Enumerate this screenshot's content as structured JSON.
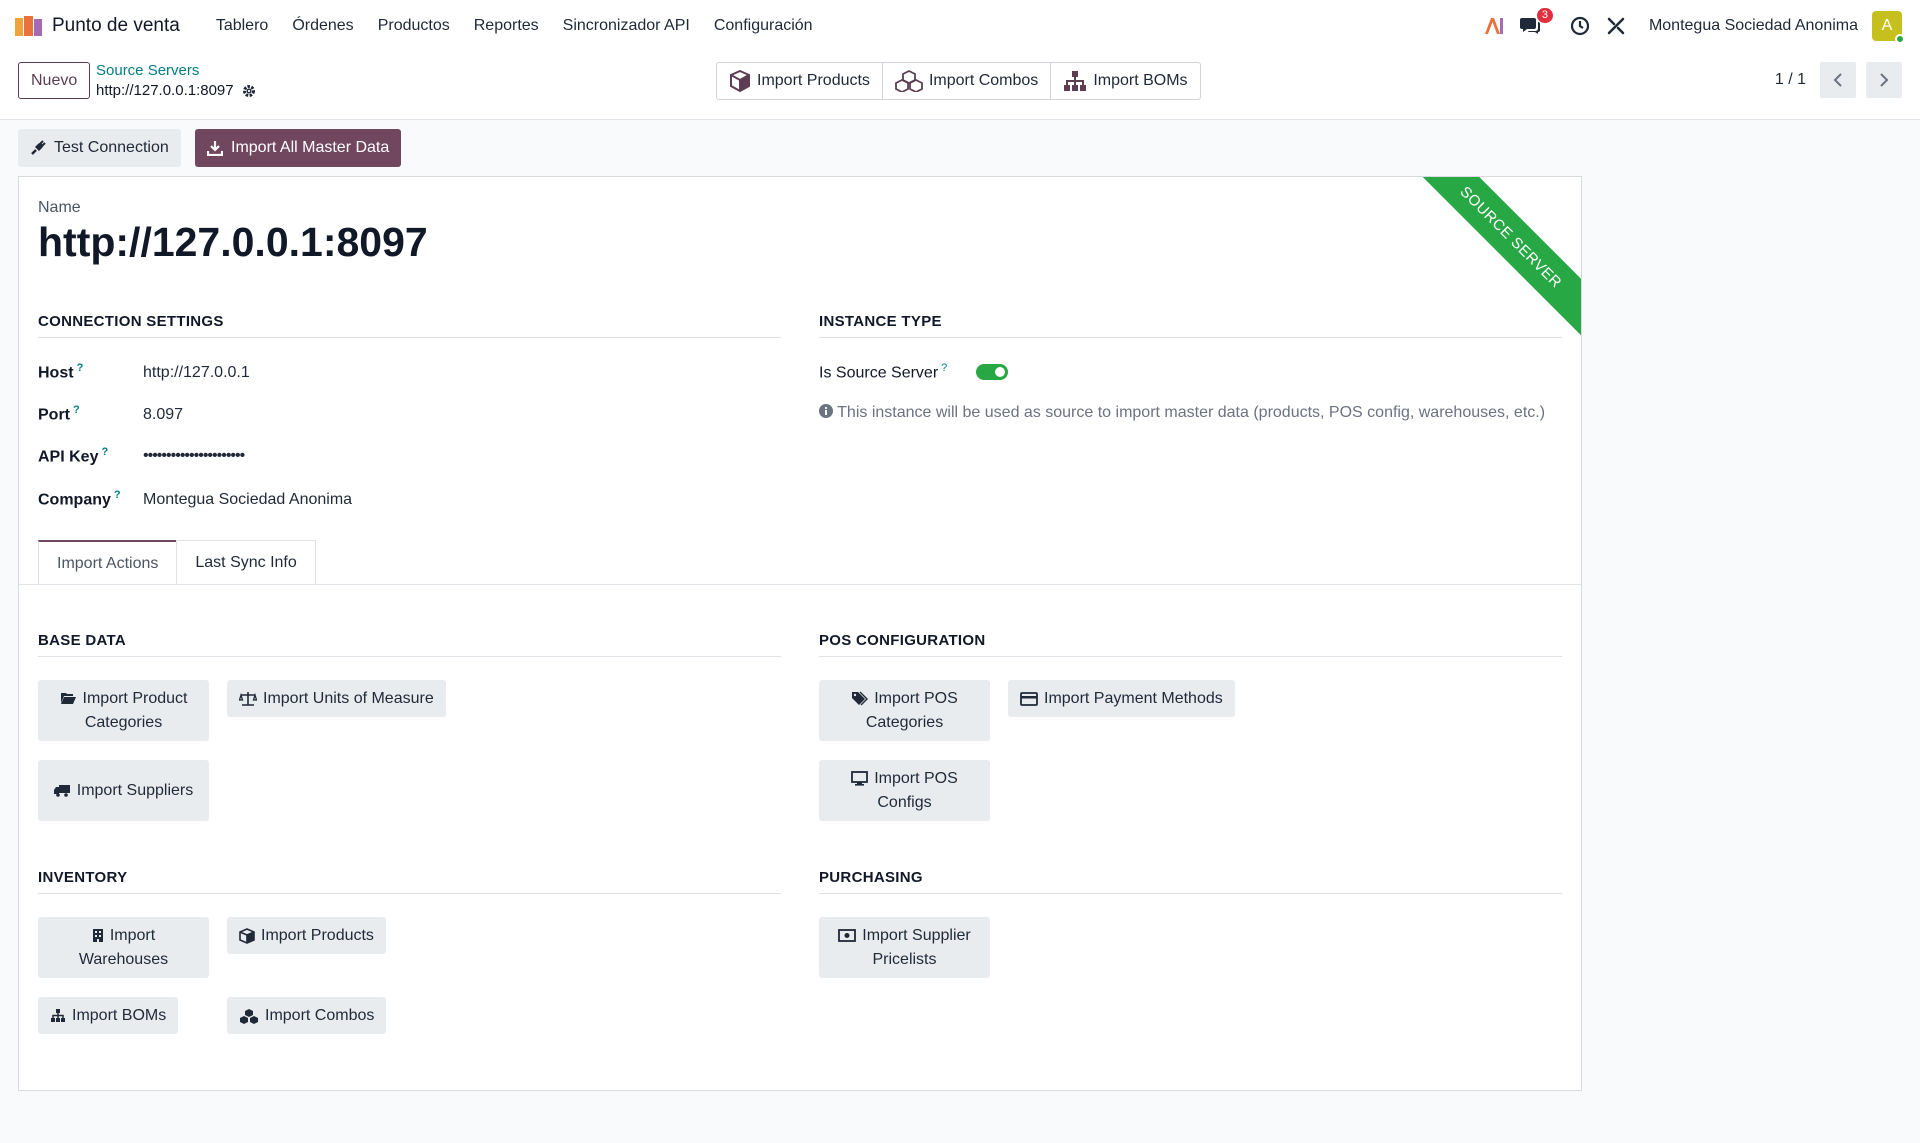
{
  "navbar": {
    "app_name": "Punto de venta",
    "menu": [
      "Tablero",
      "Órdenes",
      "Productos",
      "Reportes",
      "Sincronizador API",
      "Configuración"
    ],
    "chat_badge": "3",
    "company": "Montegua Sociedad Anonima",
    "avatar_letter": "A",
    "avatar_color": "#c6c01e"
  },
  "control": {
    "new_label": "Nuevo",
    "breadcrumb_parent": "Source Servers",
    "breadcrumb_current": "http://127.0.0.1:8097",
    "buttons": [
      "Import Products",
      "Import Combos",
      "Import BOMs"
    ],
    "pager": "1 / 1"
  },
  "actions": {
    "test_connection": "Test Connection",
    "import_all": "Import All Master Data",
    "primary_color": "#71465f"
  },
  "form": {
    "ribbon": "SOURCE SERVER",
    "ribbon_color": "#28a745",
    "name_label": "Name",
    "name_value": "http://127.0.0.1:8097",
    "connection_title": "CONNECTION SETTINGS",
    "host_label": "Host",
    "host_value": "http://127.0.0.1",
    "port_label": "Port",
    "port_value": "8.097",
    "api_key_label": "API Key",
    "api_key_value": "••••••••••••••••••••••",
    "company_label": "Company",
    "company_value": "Montegua Sociedad Anonima",
    "instance_title": "INSTANCE TYPE",
    "is_source_label": "Is Source Server",
    "is_source_value": true,
    "info_text": "This instance will be used as source to import master data (products, POS config, warehouses, etc.)",
    "help_mark": "?"
  },
  "tabs": [
    "Import Actions",
    "Last Sync Info"
  ],
  "import": {
    "base_data_title": "BASE DATA",
    "pos_config_title": "POS CONFIGURATION",
    "inventory_title": "INVENTORY",
    "purchasing_title": "PURCHASING",
    "product_categories": "Import Product Categories",
    "units_of_measure": "Import Units of Measure",
    "suppliers": "Import Suppliers",
    "pos_categories": "Import POS Categories",
    "payment_methods": "Import Payment Methods",
    "pos_configs": "Import POS Configs",
    "warehouses": "Import Warehouses",
    "products": "Import Products",
    "boms": "Import BOMs",
    "combos": "Import Combos",
    "supplier_pricelists": "Import Supplier Pricelists"
  }
}
